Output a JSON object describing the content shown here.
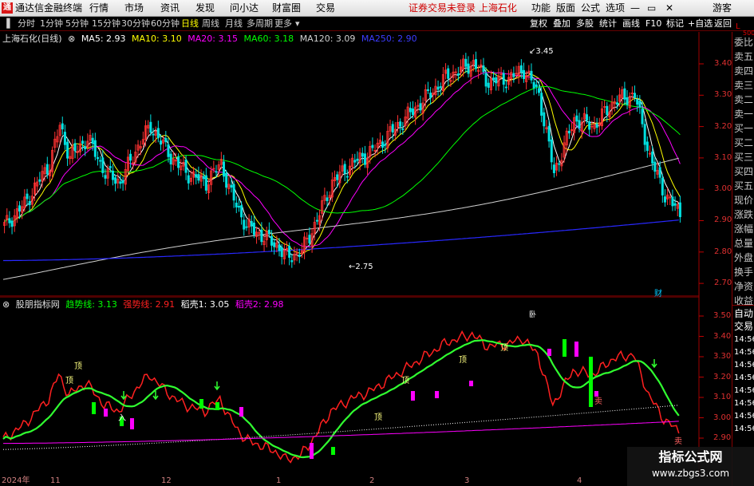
{
  "app": {
    "title": "通达信金融终端",
    "menu": [
      "行情",
      "市场",
      "资讯",
      "发现",
      "问小达",
      "财富圈",
      "交易"
    ],
    "notice": "证券交易未登录 上海石化",
    "right_menu": [
      "功能",
      "版面",
      "公式",
      "选项"
    ],
    "user": "游客"
  },
  "timeframes": {
    "items": [
      "分时",
      "1分钟",
      "5分钟",
      "15分钟",
      "30分钟",
      "60分钟",
      "日线",
      "周线",
      "月线",
      "多周期",
      "更多"
    ],
    "active": "日线",
    "right_tools": [
      "复权",
      "叠加",
      "多股",
      "统计",
      "画线",
      "F10",
      "标记",
      "+自选",
      "返回"
    ]
  },
  "main_legend": {
    "title": "上海石化(日线)",
    "ma": [
      {
        "label": "MA5: 2.93",
        "color": "#ffffff"
      },
      {
        "label": "MA10: 3.10",
        "color": "#ffff00"
      },
      {
        "label": "MA20: 3.15",
        "color": "#ff00ff"
      },
      {
        "label": "MA60: 3.18",
        "color": "#00ff00"
      },
      {
        "label": "MA120: 3.09",
        "color": "#d0d0d0"
      },
      {
        "label": "MA250: 2.90",
        "color": "#2828ff"
      }
    ]
  },
  "main_yaxis": [
    "3.40",
    "3.30",
    "3.20",
    "3.10",
    "3.00",
    "2.90",
    "2.80",
    "2.70"
  ],
  "main_annotations": {
    "high": "3.45",
    "low": "2.75",
    "cai": "财"
  },
  "indicator_legend": {
    "title": "股朋指标网",
    "items": [
      {
        "label": "趋势线: 3.13",
        "color": "#00ff00"
      },
      {
        "label": "强势线: 2.91",
        "color": "#ff2020"
      },
      {
        "label": "稻壳1: 3.05",
        "color": "#ffffff"
      },
      {
        "label": "稻壳2: 2.98",
        "color": "#ff00ff"
      }
    ],
    "top_mark": "卧"
  },
  "ind_yaxis": [
    "3.50",
    "3.40",
    "3.30",
    "3.20",
    "3.10",
    "3.00",
    "2.90"
  ],
  "ind_marks": {
    "ding": "顶",
    "ru": "入",
    "mai": "卖"
  },
  "xaxis": [
    "2024年",
    "11",
    "12",
    "1",
    "2",
    "3",
    "4"
  ],
  "right_panel": {
    "top": [
      "L",
      "500"
    ],
    "labels": [
      "委比",
      "卖五",
      "卖四",
      "卖三",
      "卖二",
      "卖一",
      "买一",
      "买二",
      "买三",
      "买四",
      "买五",
      "现价",
      "涨跌",
      "涨幅",
      "总量",
      "外盘",
      "换手",
      "净资",
      "收益"
    ],
    "ind": [
      "自动",
      "交易",
      "14:56",
      "14:56",
      "14:56",
      "14:56",
      "14:56",
      "14:56",
      "14:56",
      "14:56"
    ]
  },
  "watermark": {
    "line1": "指标公式网",
    "line2": "www.zbgs3.com"
  },
  "colors": {
    "up": "#ff3232",
    "down": "#00e0e0",
    "menu_bg": "#e6e6e6",
    "accent_red": "#d00000"
  }
}
